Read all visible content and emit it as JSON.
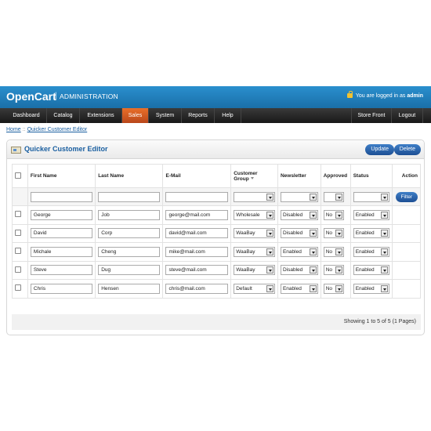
{
  "header": {
    "brand": "OpenCart",
    "separator": "|",
    "subtitle": "ADMINISTRATION",
    "login_text": "You are logged in as",
    "username": "admin"
  },
  "menu": {
    "items": [
      "Dashboard",
      "Catalog",
      "Extensions",
      "Sales",
      "System",
      "Reports",
      "Help"
    ],
    "active": "Sales",
    "store_front": "Store Front",
    "logout": "Logout"
  },
  "breadcrumb": {
    "home": "Home",
    "separator": "::",
    "current": "Quicker Customer Editor"
  },
  "panel": {
    "title": "Quicker Customer Editor",
    "update_label": "Update",
    "delete_label": "Delete"
  },
  "table": {
    "headers": {
      "first_name": "First Name",
      "last_name": "Last Name",
      "email": "E-Mail",
      "customer_group_1": "Customer",
      "customer_group_2": "Group",
      "newsletter": "Newsletter",
      "approved": "Approved",
      "status": "Status",
      "action": "Action"
    },
    "filter_label": "Filter",
    "rows": [
      {
        "first_name": "George",
        "last_name": "Job",
        "email": "george@mail.com",
        "group": "Wholesale",
        "newsletter": "Disabled",
        "approved": "No",
        "status": "Enabled"
      },
      {
        "first_name": "David",
        "last_name": "Corp",
        "email": "david@mail.com",
        "group": "WaaBay",
        "newsletter": "Disabled",
        "approved": "No",
        "status": "Enabled"
      },
      {
        "first_name": "Michale",
        "last_name": "Cheng",
        "email": "mike@mail.com",
        "group": "WaaBay",
        "newsletter": "Enabled",
        "approved": "No",
        "status": "Enabled"
      },
      {
        "first_name": "Steve",
        "last_name": "Dug",
        "email": "steve@mail.com",
        "group": "WaaBay",
        "newsletter": "Disabled",
        "approved": "No",
        "status": "Enabled"
      },
      {
        "first_name": "Chris",
        "last_name": "Hensen",
        "email": "chris@mail.com",
        "group": "Default",
        "newsletter": "Enabled",
        "approved": "No",
        "status": "Enabled"
      }
    ]
  },
  "pagination": "Showing 1 to 5 of 5 (1 Pages)",
  "colors": {
    "header_blue": "#1a6fa8",
    "menu_dark": "#181818",
    "active_orange": "#e9702a",
    "link_blue": "#1a5fa0"
  }
}
